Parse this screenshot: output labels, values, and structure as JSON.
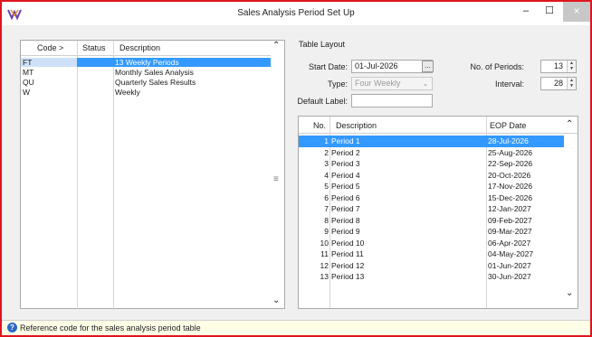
{
  "window": {
    "title": "Sales Analysis Period Set Up",
    "minimize_glyph": "–",
    "maximize_glyph": "☐",
    "close_glyph": "×",
    "accent_color": "#3399ff",
    "border_color": "#e0141e"
  },
  "codes_table": {
    "headers": {
      "code": "Code >",
      "status": "Status",
      "description": "Description"
    },
    "rows": [
      {
        "code": "FT",
        "status": "",
        "description": "13 Weekly Periods",
        "selected": true
      },
      {
        "code": "MT",
        "status": "",
        "description": "Monthly Sales Analysis",
        "selected": false
      },
      {
        "code": "QU",
        "status": "",
        "description": "Quarterly Sales Results",
        "selected": false
      },
      {
        "code": "W",
        "status": "",
        "description": "Weekly",
        "selected": false
      }
    ],
    "scroll_up_icon": "chevron-up-icon",
    "scroll_down_icon": "chevron-down-icon"
  },
  "table_layout": {
    "group_label": "Table Layout",
    "start_date_label": "Start Date:",
    "start_date_value": "01-Jul-2026",
    "date_picker_glyph": "...",
    "type_label": "Type:",
    "type_value": "Four Weekly",
    "default_label_label": "Default Label:",
    "default_label_value": "",
    "no_periods_label": "No. of Periods:",
    "no_periods_value": "13",
    "interval_label": "Interval:",
    "interval_value": "28"
  },
  "periods_table": {
    "headers": {
      "no": "No.",
      "description": "Description",
      "eop": "EOP Date"
    },
    "rows": [
      {
        "no": "1",
        "description": "Period 1",
        "eop": "28-Jul-2026",
        "selected": true
      },
      {
        "no": "2",
        "description": "Period 2",
        "eop": "25-Aug-2026",
        "selected": false
      },
      {
        "no": "3",
        "description": "Period 3",
        "eop": "22-Sep-2026",
        "selected": false
      },
      {
        "no": "4",
        "description": "Period 4",
        "eop": "20-Oct-2026",
        "selected": false
      },
      {
        "no": "5",
        "description": "Period 5",
        "eop": "17-Nov-2026",
        "selected": false
      },
      {
        "no": "6",
        "description": "Period 6",
        "eop": "15-Dec-2026",
        "selected": false
      },
      {
        "no": "7",
        "description": "Period 7",
        "eop": "12-Jan-2027",
        "selected": false
      },
      {
        "no": "8",
        "description": "Period 8",
        "eop": "09-Feb-2027",
        "selected": false
      },
      {
        "no": "9",
        "description": "Period 9",
        "eop": "09-Mar-2027",
        "selected": false
      },
      {
        "no": "10",
        "description": "Period 10",
        "eop": "06-Apr-2027",
        "selected": false
      },
      {
        "no": "11",
        "description": "Period 11",
        "eop": "04-May-2027",
        "selected": false
      },
      {
        "no": "12",
        "description": "Period 12",
        "eop": "01-Jun-2027",
        "selected": false
      },
      {
        "no": "13",
        "description": "Period 13",
        "eop": "30-Jun-2027",
        "selected": false
      }
    ]
  },
  "status_bar": {
    "help_icon": "help-icon",
    "text": "Reference code for the sales analysis period table"
  }
}
